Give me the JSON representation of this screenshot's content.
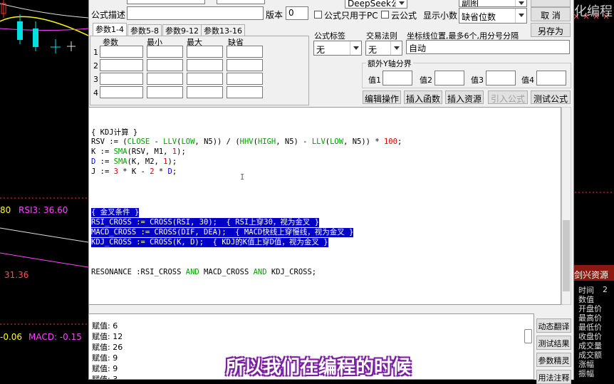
{
  "chart": {
    "rsi_label": "RSI3: 36.60",
    "rsi_left": "80",
    "kdj_value": "31.36",
    "macd_left": "-0.06",
    "macd_label": "MACD: -0.15"
  },
  "right_panel": {
    "watermark": "化编程",
    "resource_title": "剑兴资源",
    "items": [
      "时间",
      "数值",
      "开盘价",
      "最高价",
      "最低价",
      "收盘价",
      "成交量",
      "成交额",
      "涨幅",
      "振幅"
    ],
    "extra": "2"
  },
  "dialog": {
    "desc_label": "公式描述",
    "version_label": "版本",
    "version_value": "0",
    "type_value": "DeepSeek公式",
    "pc_only_label": "公式只用于PC",
    "cloud_label": "云公式",
    "decimals_label": "显示小数",
    "decimals_value": "缺省位数",
    "top_combo_value": "副图",
    "tabs": [
      "参数1-4",
      "参数5-8",
      "参数9-12",
      "参数13-16"
    ],
    "param_headers": [
      "参数",
      "最小",
      "最大",
      "缺省"
    ],
    "param_rows": [
      "1",
      "2",
      "3",
      "4"
    ],
    "formula_tag_label": "公式标签",
    "formula_tag_value": "无",
    "trade_rule_label": "交易法则",
    "trade_rule_value": "无",
    "axis_label": "坐标线位置,最多6个,用分号分隔",
    "axis_value": "自动",
    "extra_y_label": "额外Y轴分界",
    "values": [
      "值1",
      "值2",
      "值3",
      "值4"
    ],
    "buttons": {
      "ok": "",
      "cancel": "取 消",
      "save_as": "另存为",
      "edit_op": "编辑操作",
      "insert_func": "插入函数",
      "insert_res": "插入资源",
      "import_formula": "引入公式",
      "test_formula": "测试公式",
      "dyn_translate": "动态翻译",
      "test_result": "测试结果",
      "param_wizard": "参数精灵",
      "usage_note": "用法注释"
    }
  },
  "code": {
    "kdj_comment": "{ KDJ计算 }",
    "cross_comment": "{ 金叉条件 }",
    "resonance": "RESONANCE :RSI_CROSS AND MACD_CROSS AND KDJ_CROSS;"
  },
  "output_lines": [
    "赋值: 6",
    "赋值: 12",
    "赋值: 26",
    "赋值: 9",
    "赋值: 9",
    "赋值: 3"
  ],
  "subtitle": "所以我们在编程的时候"
}
